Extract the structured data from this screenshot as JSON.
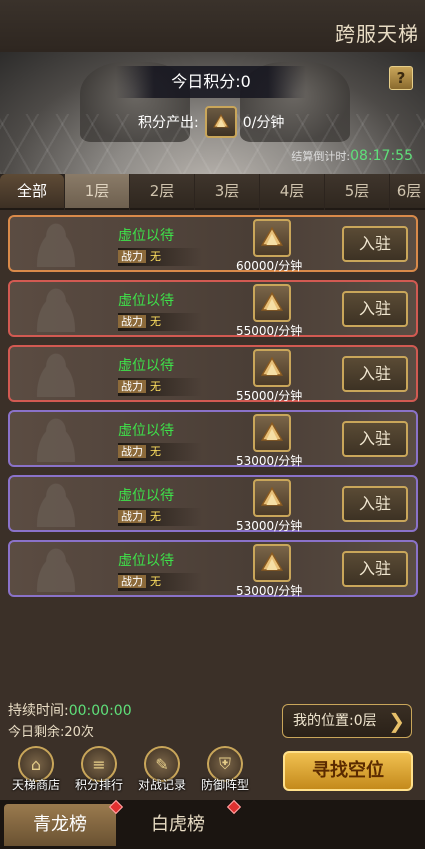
{
  "header": {
    "title": "跨服天梯"
  },
  "banner": {
    "score_text": "今日积分:0",
    "output_label": "积分产出:",
    "output_rate": "0/分钟",
    "countdown_label": "结算倒计时:",
    "countdown_time": "08:17:55",
    "help_icon": "?"
  },
  "tabs": [
    "全部",
    "1层",
    "2层",
    "3层",
    "4层",
    "5层",
    "6层"
  ],
  "slots": [
    {
      "status": "虚位以待",
      "power_label": "战力",
      "power_value": "无",
      "rate": "60000/分钟",
      "button": "入驻"
    },
    {
      "status": "虚位以待",
      "power_label": "战力",
      "power_value": "无",
      "rate": "55000/分钟",
      "button": "入驻"
    },
    {
      "status": "虚位以待",
      "power_label": "战力",
      "power_value": "无",
      "rate": "55000/分钟",
      "button": "入驻"
    },
    {
      "status": "虚位以待",
      "power_label": "战力",
      "power_value": "无",
      "rate": "53000/分钟",
      "button": "入驻"
    },
    {
      "status": "虚位以待",
      "power_label": "战力",
      "power_value": "无",
      "rate": "53000/分钟",
      "button": "入驻"
    },
    {
      "status": "虚位以待",
      "power_label": "战力",
      "power_value": "无",
      "rate": "53000/分钟",
      "button": "入驻"
    }
  ],
  "info": {
    "duration_label": "持续时间:",
    "duration_time": "00:00:00",
    "remain_text": "今日剩余:20次",
    "my_position": "我的位置:0层"
  },
  "actions": {
    "shop": "天梯商店",
    "rank": "积分排行",
    "record": "对战记录",
    "defense": "防御阵型",
    "find": "寻找空位"
  },
  "footer": {
    "tab1": "青龙榜",
    "tab2": "白虎榜"
  }
}
